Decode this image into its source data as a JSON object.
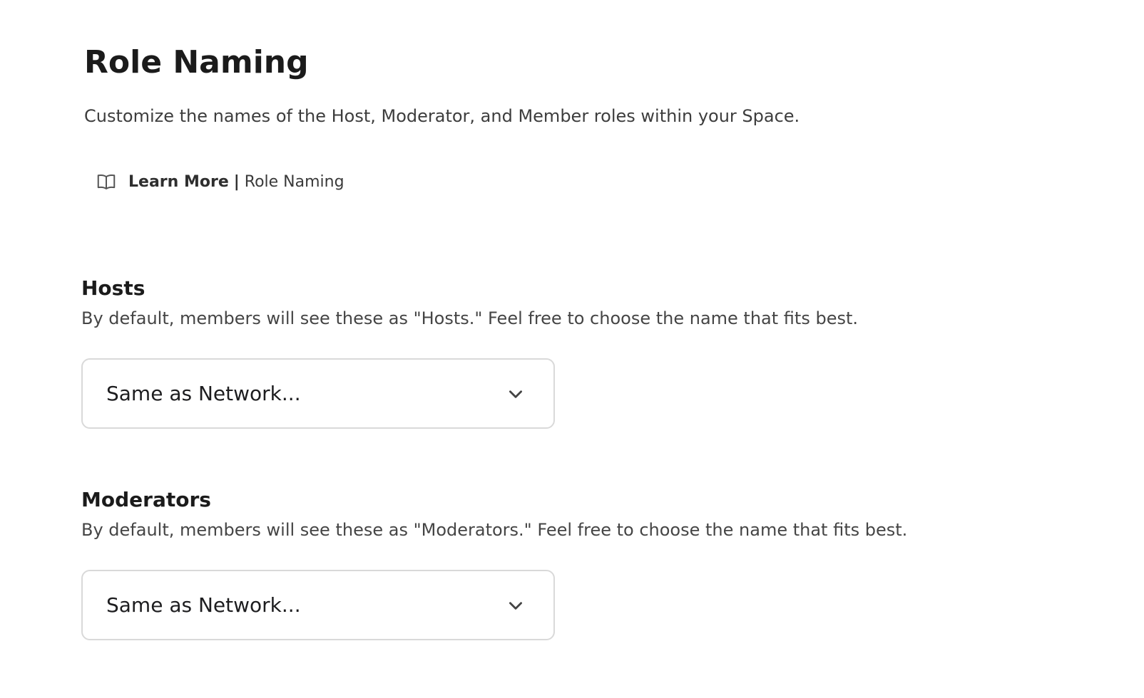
{
  "page": {
    "title": "Role Naming",
    "description": "Customize the names of the Host, Moderator, and Member roles within your Space."
  },
  "learn_more": {
    "icon": "book-open-icon",
    "bold_label": "Learn More",
    "separator": "|",
    "label": "Role Naming"
  },
  "sections": [
    {
      "title": "Hosts",
      "description": "By default, members will see these as \"Hosts.\" Feel free to choose the name that fits best.",
      "select": {
        "value": "Same as Network...",
        "icon": "chevron-down-icon"
      }
    },
    {
      "title": "Moderators",
      "description": "By default, members will see these as \"Moderators.\" Feel free to choose the name that fits best.",
      "select": {
        "value": "Same as Network...",
        "icon": "chevron-down-icon"
      }
    }
  ]
}
